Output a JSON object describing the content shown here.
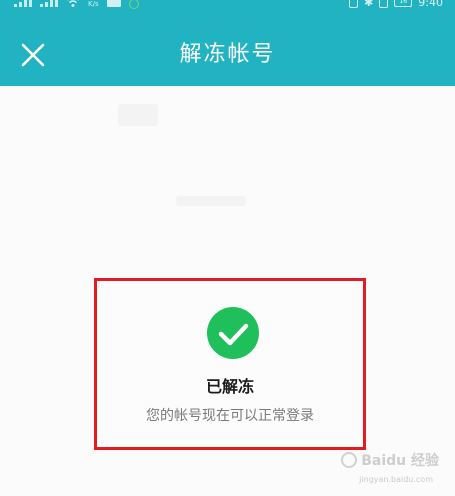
{
  "status_bar": {
    "speed": "K/s",
    "battery_level": "16",
    "time": "9:40"
  },
  "header": {
    "title": "解冻帐号",
    "close_icon": "close-icon"
  },
  "result": {
    "icon": "check-circle-icon",
    "title": "已解冻",
    "description": "您的帐号现在可以正常登录"
  },
  "watermark": {
    "text": "Baidu 经验",
    "subtext": "jingyan.baidu.com"
  },
  "colors": {
    "header_bg": "#22b3c2",
    "success_green": "#1fc05b",
    "highlight_red": "#e11d24"
  }
}
